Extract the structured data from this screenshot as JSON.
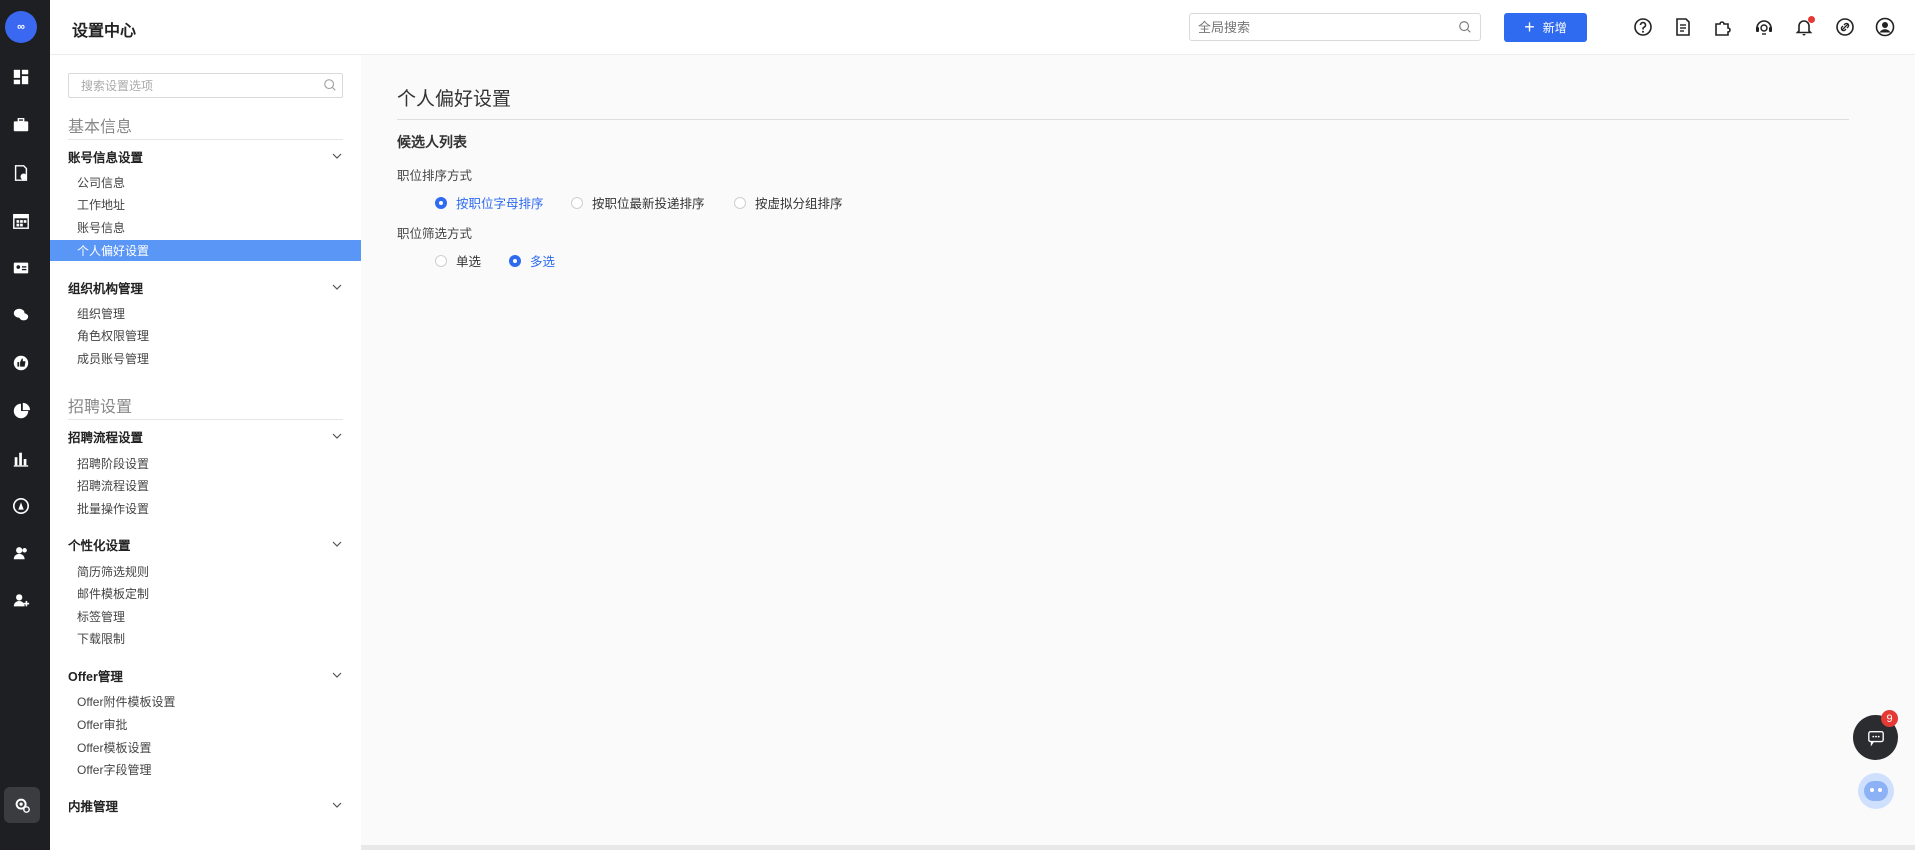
{
  "header": {
    "title": "设置中心",
    "search_placeholder": "全局搜索",
    "new_button_label": "新增",
    "icons": [
      "help-icon",
      "document-icon",
      "plugin-icon",
      "support-icon",
      "bell-icon",
      "link-icon",
      "user-icon"
    ]
  },
  "rail": {
    "logo_text": "∞",
    "icons": [
      "dashboard-icon",
      "briefcase-icon",
      "resume-icon",
      "calendar-icon",
      "id-card-icon",
      "wechat-icon",
      "thumbs-up-icon",
      "pie-chart-icon",
      "bar-chart-icon",
      "contact-icon",
      "team-icon",
      "member-icon",
      "settings-icon"
    ]
  },
  "sidebar": {
    "search_placeholder": "搜索设置选项",
    "sections": [
      {
        "title": "基本信息",
        "groups": [
          {
            "label": "账号信息设置",
            "items": [
              "公司信息",
              "工作地址",
              "账号信息",
              "个人偏好设置"
            ]
          },
          {
            "label": "组织机构管理",
            "items": [
              "组织管理",
              "角色权限管理",
              "成员账号管理"
            ]
          }
        ]
      },
      {
        "title": "招聘设置",
        "groups": [
          {
            "label": "招聘流程设置",
            "items": [
              "招聘阶段设置",
              "招聘流程设置",
              "批量操作设置"
            ]
          },
          {
            "label": "个性化设置",
            "items": [
              "简历筛选规则",
              "邮件模板定制",
              "标签管理",
              "下载限制"
            ]
          },
          {
            "label": "Offer管理",
            "items": [
              "Offer附件模板设置",
              "Offer审批",
              "Offer模板设置",
              "Offer字段管理"
            ]
          },
          {
            "label": "内推管理",
            "items": []
          }
        ]
      }
    ],
    "active_item": "个人偏好设置"
  },
  "main": {
    "page_title": "个人偏好设置",
    "section_title": "候选人列表",
    "sort_label": "职位排序方式",
    "sort_options": [
      "按职位字母排序",
      "按职位最新投递排序",
      "按虚拟分组排序"
    ],
    "sort_selected": "按职位字母排序",
    "filter_label": "职位筛选方式",
    "filter_options": [
      "单选",
      "多选"
    ],
    "filter_selected": "多选"
  },
  "floating": {
    "chat_badge_count": "9"
  },
  "colors": {
    "accent": "#2f6bf0",
    "rail_bg": "#1e1f22",
    "active_item_bg": "#5a96f5",
    "badge": "#e53935"
  }
}
